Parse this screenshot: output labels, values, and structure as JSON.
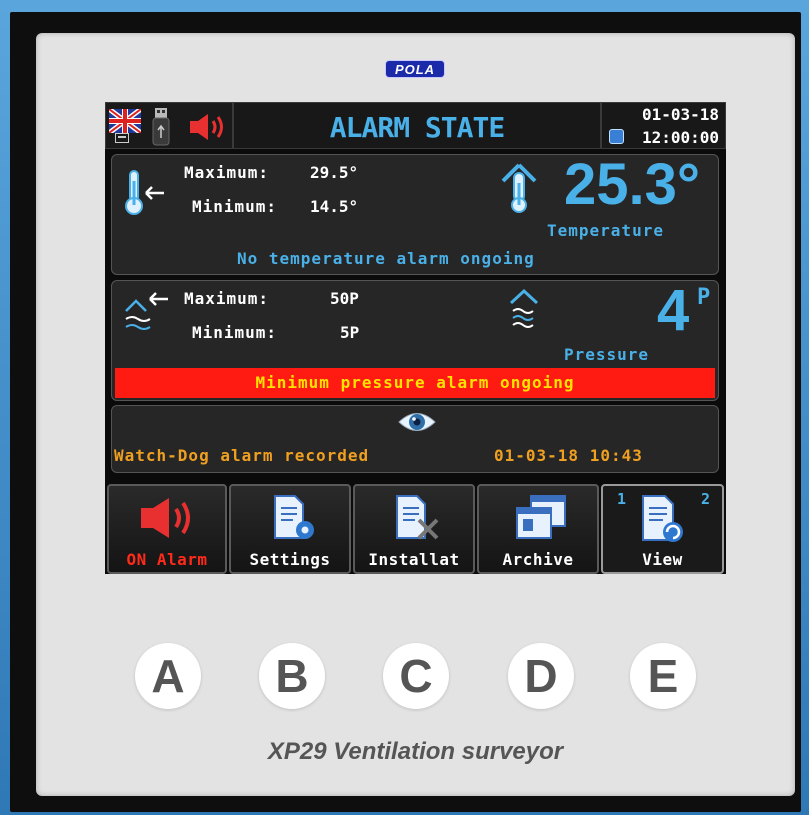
{
  "device": {
    "brand": "POLA",
    "caption": "XP29 Ventilation surveyor",
    "physical_buttons": [
      "A",
      "B",
      "C",
      "D",
      "E"
    ]
  },
  "header": {
    "title": "ALARM STATE",
    "date": "01-03-18",
    "time": "12:00:00",
    "icons": [
      "uk-flag-icon",
      "usb-icon",
      "speaker-alarm-icon"
    ]
  },
  "temperature": {
    "max_label": "Maximum:",
    "max_value": "29.5°",
    "min_label": "Minimum:",
    "min_value": "14.5°",
    "current": "25.3°",
    "label": "Temperature",
    "status": "No temperature alarm ongoing"
  },
  "pressure": {
    "max_label": "Maximum:",
    "max_value": "50P",
    "min_label": "Minimum:",
    "min_value": "5P",
    "current": "4",
    "unit": "P",
    "label": "Pressure",
    "alarm": "Minimum pressure alarm ongoing"
  },
  "watchdog": {
    "text": "Watch-Dog alarm recorded",
    "datetime": "01-03-18  10:43"
  },
  "menu": {
    "alarm": "ON Alarm",
    "settings": "Settings",
    "install": "Installat",
    "archive": "Archive",
    "view": "View",
    "view_page1": "1",
    "view_page2": "2"
  },
  "colors": {
    "accent_blue": "#4ab0e8",
    "alarm_red": "#ff1a12",
    "alarm_yellow": "#ffe400",
    "orange": "#f0a020"
  }
}
